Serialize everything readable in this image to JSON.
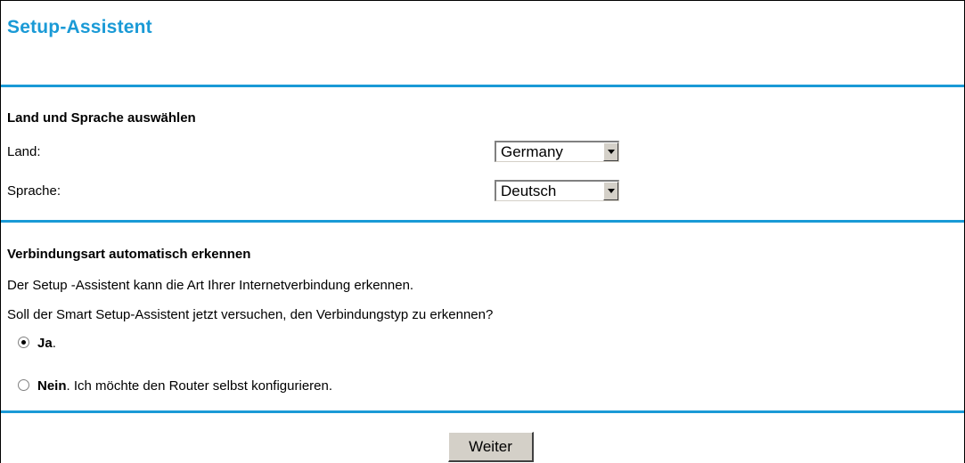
{
  "header": {
    "title": "Setup-Assistent"
  },
  "colors": {
    "accent": "#1a9ad6",
    "button_face": "#d4d0c8"
  },
  "region": {
    "heading": "Land und Sprache auswählen",
    "country_label": "Land:",
    "country_value": "Germany",
    "language_label": "Sprache:",
    "language_value": "Deutsch"
  },
  "detect": {
    "heading": "Verbindungsart automatisch erkennen",
    "line1": "Der Setup -Assistent kann die Art Ihrer Internetverbindung erkennen.",
    "line2": "Soll der Smart Setup-Assistent jetzt versuchen, den Verbindungstyp zu erkennen?",
    "options": [
      {
        "bold": "Ja",
        "rest": ".",
        "selected": true
      },
      {
        "bold": "Nein",
        "rest": ". Ich möchte den Router selbst konfigurieren.",
        "selected": false
      }
    ]
  },
  "footer": {
    "next_label": "Weiter"
  },
  "icons": {
    "dropdown": "chevron-down-icon",
    "radio": "radio-icon"
  }
}
